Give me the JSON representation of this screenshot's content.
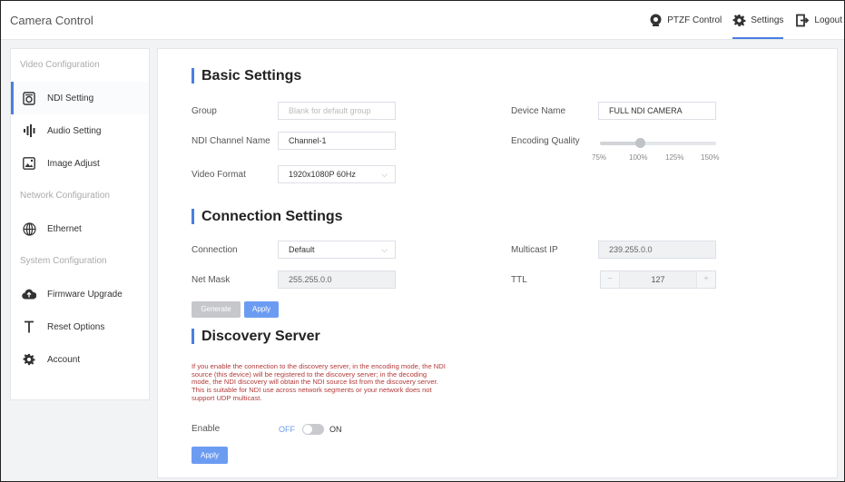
{
  "app_title": "Camera Control",
  "nav": {
    "ptzf": "PTZF Control",
    "settings": "Settings",
    "logout": "Logout",
    "active": "settings"
  },
  "sidebar": {
    "sections": [
      "Video Configuration",
      "Network Configuration",
      "System Configuration"
    ],
    "items": {
      "ndi": "NDI Setting",
      "audio": "Audio Setting",
      "image": "Image Adjust",
      "ethernet": "Ethernet",
      "firmware": "Firmware Upgrade",
      "reset": "Reset Options",
      "account": "Account"
    },
    "active": "ndi"
  },
  "basic": {
    "title": "Basic Settings",
    "group_label": "Group",
    "group_placeholder": "Blank for default group",
    "device_name_label": "Device Name",
    "device_name_value": "FULL NDI CAMERA",
    "channel_label": "NDI Channel Name",
    "channel_value": "Channel-1",
    "encoding_label": "Encoding Quality",
    "encoding_ticks": [
      "75%",
      "100%",
      "125%",
      "150%"
    ],
    "encoding_value": "100%",
    "video_format_label": "Video Format",
    "video_format_value": "1920x1080P 60Hz"
  },
  "connection": {
    "title": "Connection Settings",
    "connection_label": "Connection",
    "connection_value": "Default",
    "multicast_label": "Multicast IP",
    "multicast_value": "239.255.0.0",
    "netmask_label": "Net Mask",
    "netmask_value": "255.255.0.0",
    "ttl_label": "TTL",
    "ttl_value": "127",
    "ttl_minus": "−",
    "ttl_plus": "+",
    "generate_label": "Generate",
    "apply_label": "Apply"
  },
  "discovery": {
    "title": "Discovery Server",
    "description": "If you enable the connection to the discovery server, in the encoding mode, the NDI source (this device) will be registered to the discovery server; in the decoding mode, the NDI discovery will obtain the NDI source list from the discovery server. This is suitable for NDI use across network segments or your network does not support UDP multicast.",
    "enable_label": "Enable",
    "off_label": "OFF",
    "on_label": "ON",
    "enabled": false,
    "apply_label": "Apply"
  },
  "colors": {
    "accent": "#4a7fe0",
    "button": "#6b9cf2",
    "warning_text": "#b33a3a"
  }
}
